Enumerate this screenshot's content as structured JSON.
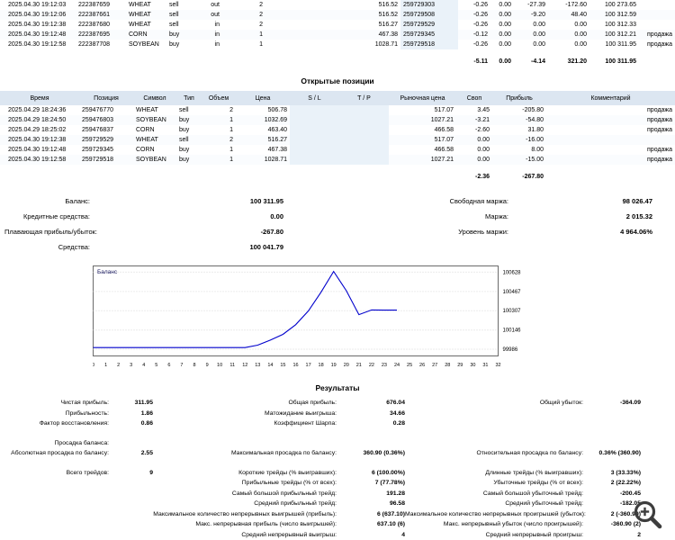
{
  "colors": {
    "line": "#0000CC",
    "table_header_bg": "#dce6f1",
    "shaded_col_bg": "#eaf2f9"
  },
  "icons": {
    "zoom": "zoom-in-magnifier"
  },
  "deals_table": {
    "rows": [
      {
        "time": "2025.04.30 19:12:03",
        "deal": "222387659",
        "symbol": "WHEAT",
        "type": "sell",
        "direction": "out",
        "volume": "2",
        "price": "516.52",
        "order": "259729303",
        "commission": "-0.26",
        "fee": "0.00",
        "swap": "-27.39",
        "profit": "-172.60",
        "balance": "100 273.65",
        "comment": ""
      },
      {
        "time": "2025.04.30 19:12:06",
        "deal": "222387661",
        "symbol": "WHEAT",
        "type": "sell",
        "direction": "out",
        "volume": "2",
        "price": "516.52",
        "order": "259729508",
        "commission": "-0.26",
        "fee": "0.00",
        "swap": "-9.20",
        "profit": "48.40",
        "balance": "100 312.59",
        "comment": ""
      },
      {
        "time": "2025.04.30 19:12:38",
        "deal": "222387680",
        "symbol": "WHEAT",
        "type": "sell",
        "direction": "in",
        "volume": "2",
        "price": "516.27",
        "order": "259729529",
        "commission": "-0.26",
        "fee": "0.00",
        "swap": "0.00",
        "profit": "0.00",
        "balance": "100 312.33",
        "comment": ""
      },
      {
        "time": "2025.04.30 19:12:48",
        "deal": "222387695",
        "symbol": "CORN",
        "type": "buy",
        "direction": "in",
        "volume": "1",
        "price": "467.38",
        "order": "259729345",
        "commission": "-0.12",
        "fee": "0.00",
        "swap": "0.00",
        "profit": "0.00",
        "balance": "100 312.21",
        "comment": "продажа"
      },
      {
        "time": "2025.04.30 19:12:58",
        "deal": "222387708",
        "symbol": "SOYBEAN",
        "type": "buy",
        "direction": "in",
        "volume": "1",
        "price": "1028.71",
        "order": "259729518",
        "commission": "-0.26",
        "fee": "0.00",
        "swap": "0.00",
        "profit": "0.00",
        "balance": "100 311.95",
        "comment": "продажа"
      }
    ],
    "totals": {
      "commission": "-5.11",
      "fee": "0.00",
      "swap": "-4.14",
      "profit": "321.20",
      "balance": "100 311.95"
    }
  },
  "open_positions": {
    "title": "Открытые позиции",
    "headers": [
      "Время",
      "Позиция",
      "Символ",
      "Тип",
      "Объем",
      "Цена",
      "S / L",
      "T / P",
      "Рыночная цена",
      "Своп",
      "Прибыль",
      "Комментарий"
    ],
    "rows": [
      {
        "time": "2025.04.29 18:24:36",
        "position": "259476770",
        "symbol": "WHEAT",
        "type": "sell",
        "volume": "2",
        "price": "506.78",
        "sl": "",
        "tp": "",
        "market_price": "517.07",
        "swap": "3.45",
        "profit": "-205.80",
        "comment": "продажа"
      },
      {
        "time": "2025.04.29 18:24:50",
        "position": "259476803",
        "symbol": "SOYBEAN",
        "type": "buy",
        "volume": "1",
        "price": "1032.69",
        "sl": "",
        "tp": "",
        "market_price": "1027.21",
        "swap": "-3.21",
        "profit": "-54.80",
        "comment": "продажа"
      },
      {
        "time": "2025.04.29 18:25:02",
        "position": "259476837",
        "symbol": "CORN",
        "type": "buy",
        "volume": "1",
        "price": "463.40",
        "sl": "",
        "tp": "",
        "market_price": "466.58",
        "swap": "-2.60",
        "profit": "31.80",
        "comment": "продажа"
      },
      {
        "time": "2025.04.30 19:12:38",
        "position": "259729529",
        "symbol": "WHEAT",
        "type": "sell",
        "volume": "2",
        "price": "516.27",
        "sl": "",
        "tp": "",
        "market_price": "517.07",
        "swap": "0.00",
        "profit": "-16.00",
        "comment": ""
      },
      {
        "time": "2025.04.30 19:12:48",
        "position": "259729345",
        "symbol": "CORN",
        "type": "buy",
        "volume": "1",
        "price": "467.38",
        "sl": "",
        "tp": "",
        "market_price": "466.58",
        "swap": "0.00",
        "profit": "8.00",
        "comment": "продажа"
      },
      {
        "time": "2025.04.30 19:12:58",
        "position": "259729518",
        "symbol": "SOYBEAN",
        "type": "buy",
        "volume": "1",
        "price": "1028.71",
        "sl": "",
        "tp": "",
        "market_price": "1027.21",
        "swap": "0.00",
        "profit": "-15.00",
        "comment": "продажа"
      }
    ],
    "totals": {
      "swap": "-2.36",
      "profit": "-267.80"
    }
  },
  "account_summary": {
    "left": [
      {
        "label": "Баланс:",
        "value": "100 311.95"
      },
      {
        "label": "Кредитные средства:",
        "value": "0.00"
      },
      {
        "label": "Плавающая прибыль/убыток:",
        "value": "-267.80"
      },
      {
        "label": "Средства:",
        "value": "100 041.79"
      }
    ],
    "right": [
      {
        "label": "Свободная маржа:",
        "value": "98 026.47"
      },
      {
        "label": "Маржа:",
        "value": "2 015.32"
      },
      {
        "label": "Уровень маржи:",
        "value": "4 964.06%"
      }
    ]
  },
  "chart_data": {
    "type": "line",
    "title": "Баланс",
    "series": [
      {
        "name": "Баланс",
        "values": [
          100000,
          100000,
          100000,
          100000,
          100000,
          100000,
          100000,
          100000,
          100000,
          100000,
          100000,
          100000,
          100000,
          100020,
          100062,
          100110,
          100190,
          100305,
          100460,
          100634,
          100474,
          100274,
          100313,
          100312,
          100312
        ]
      }
    ],
    "x_axis": {
      "min": 0,
      "max": 32,
      "step": 1
    },
    "y_ticks": [
      100628,
      100467,
      100307,
      100146,
      99986
    ],
    "ylim": [
      99930,
      100680
    ],
    "line_color": "#0000CC",
    "grid": "horizontal-dotted",
    "legend_position": "top-left"
  },
  "results": {
    "title": "Результаты",
    "rows": [
      {
        "cells": [
          {
            "label": "Чистая прибыль:",
            "value": "311.95"
          },
          {
            "label": "Общая прибыль:",
            "value": "676.04"
          },
          {
            "label": "Общий убыток:",
            "value": "-364.09"
          }
        ]
      },
      {
        "cells": [
          {
            "label": "Прибыльность:",
            "value": "1.86"
          },
          {
            "label": "Матожидание выигрыша:",
            "value": "34.66"
          },
          {
            "label": "",
            "value": ""
          }
        ]
      },
      {
        "cells": [
          {
            "label": "Фактор восстановления:",
            "value": "0.86"
          },
          {
            "label": "Коэффициент Шарпа:",
            "value": "0.28"
          },
          {
            "label": "",
            "value": ""
          }
        ]
      },
      {
        "spacer": true
      },
      {
        "cells": [
          {
            "label": "Просадка баланса:",
            "value": ""
          },
          {
            "label": "",
            "value": ""
          },
          {
            "label": "",
            "value": ""
          }
        ]
      },
      {
        "cells": [
          {
            "label": "Абсолютная просадка по балансу:",
            "value": "2.55"
          },
          {
            "label": "Максимальная просадка по балансу:",
            "value": "360.90 (0.36%)"
          },
          {
            "label": "Относительная просадка по балансу:",
            "value": "0.36% (360.90)"
          }
        ]
      },
      {
        "spacer": true
      },
      {
        "cells": [
          {
            "label": "Всего трейдов:",
            "value": "9"
          },
          {
            "label": "Короткие трейды (% выигравших):",
            "value": "6 (100.00%)"
          },
          {
            "label": "Длинные трейды (% выигравших):",
            "value": "3 (33.33%)"
          }
        ]
      },
      {
        "cells": [
          {
            "label": "",
            "value": ""
          },
          {
            "label": "Прибыльные трейды (% от всех):",
            "value": "7 (77.78%)"
          },
          {
            "label": "Убыточные трейды (% от всех):",
            "value": "2 (22.22%)"
          }
        ]
      },
      {
        "cells": [
          {
            "label": "",
            "value": ""
          },
          {
            "label": "Самый большой прибыльный трейд:",
            "value": "191.28"
          },
          {
            "label": "Самый большой убыточный трейд:",
            "value": "-200.45"
          }
        ]
      },
      {
        "cells": [
          {
            "label": "",
            "value": ""
          },
          {
            "label": "Средний прибыльный трейд:",
            "value": "96.58"
          },
          {
            "label": "Средний убыточный трейд:",
            "value": "-182.05"
          }
        ]
      },
      {
        "cells": [
          {
            "label": "",
            "value": ""
          },
          {
            "label": "Максимальное количество непрерывных выигрышей (прибыль):",
            "value": "6 (637.10)"
          },
          {
            "label": "Максимальное количество непрерывных проигрышей (убыток):",
            "value": "2 (-360.90)"
          }
        ]
      },
      {
        "cells": [
          {
            "label": "",
            "value": ""
          },
          {
            "label": "Макс. непрерывная прибыль (число выигрышей):",
            "value": "637.10 (6)"
          },
          {
            "label": "Макс. непрерывный убыток (число проигрышей):",
            "value": "-360.90 (2)"
          }
        ]
      },
      {
        "cells": [
          {
            "label": "",
            "value": ""
          },
          {
            "label": "Средний непрерывный выигрыш:",
            "value": "4"
          },
          {
            "label": "Средний непрерывный проигрыш:",
            "value": "2"
          }
        ]
      }
    ]
  }
}
